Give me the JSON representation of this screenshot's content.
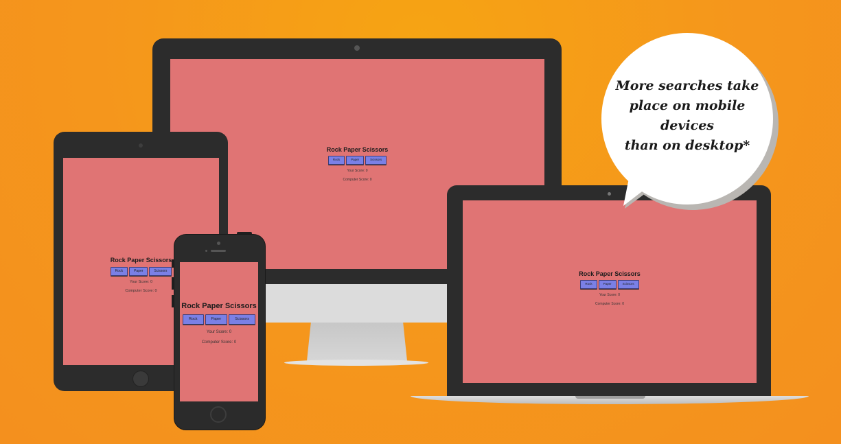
{
  "bubble": {
    "line1": "More searches take",
    "line2": "place on mobile devices",
    "line3": "than on desktop*"
  },
  "app": {
    "title": "Rock Paper Scissors",
    "buttons": [
      "Rock",
      "Paper",
      "Scissors"
    ],
    "your_score_label": "Your Score: 0",
    "computer_score_label": "Computer Score: 0"
  },
  "colors": {
    "background": "#f5961c",
    "device_frame": "#2c2c2c",
    "app_screen": "#e07474",
    "app_button": "#7a80e6"
  }
}
